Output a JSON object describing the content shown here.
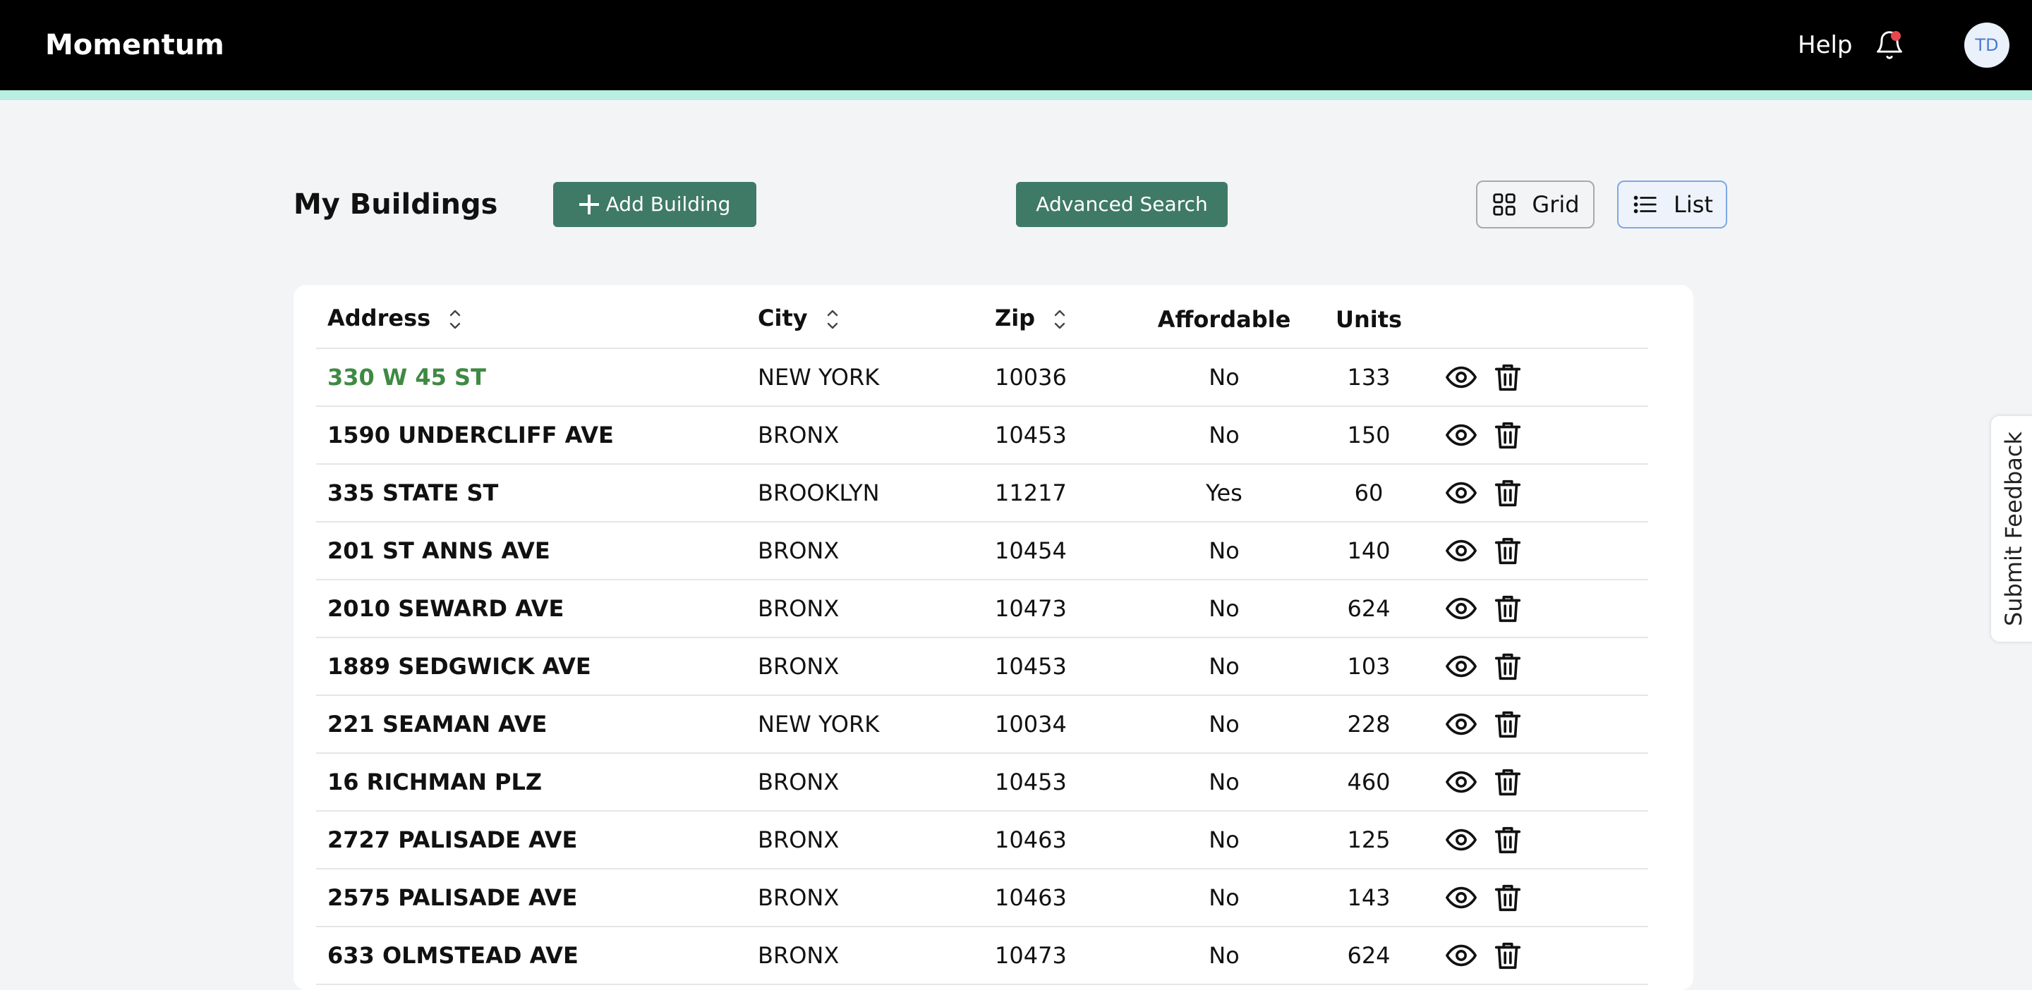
{
  "app": {
    "name": "Momentum"
  },
  "topbar": {
    "help_label": "Help",
    "avatar_initials": "TD",
    "notification_color": "#e5484d"
  },
  "header": {
    "title": "My Buildings",
    "add_button_label": "Add Building",
    "advanced_search_label": "Advanced Search",
    "view_toggle": {
      "grid_label": "Grid",
      "list_label": "List",
      "selected": "List"
    }
  },
  "table": {
    "columns": {
      "address": "Address",
      "city": "City",
      "zip": "Zip",
      "affordable": "Affordable",
      "units": "Units"
    },
    "rows": [
      {
        "address": "330 W 45 ST",
        "city": "NEW YORK",
        "zip": "10036",
        "affordable": "No",
        "units": "133"
      },
      {
        "address": "1590 UNDERCLIFF AVE",
        "city": "BRONX",
        "zip": "10453",
        "affordable": "No",
        "units": "150"
      },
      {
        "address": "335 STATE ST",
        "city": "BROOKLYN",
        "zip": "11217",
        "affordable": "Yes",
        "units": "60"
      },
      {
        "address": "201 ST ANNS AVE",
        "city": "BRONX",
        "zip": "10454",
        "affordable": "No",
        "units": "140"
      },
      {
        "address": "2010 SEWARD AVE",
        "city": "BRONX",
        "zip": "10473",
        "affordable": "No",
        "units": "624"
      },
      {
        "address": "1889 SEDGWICK AVE",
        "city": "BRONX",
        "zip": "10453",
        "affordable": "No",
        "units": "103"
      },
      {
        "address": "221 SEAMAN AVE",
        "city": "NEW YORK",
        "zip": "10034",
        "affordable": "No",
        "units": "228"
      },
      {
        "address": "16 RICHMAN PLZ",
        "city": "BRONX",
        "zip": "10453",
        "affordable": "No",
        "units": "460"
      },
      {
        "address": "2727 PALISADE AVE",
        "city": "BRONX",
        "zip": "10463",
        "affordable": "No",
        "units": "125"
      },
      {
        "address": "2575 PALISADE AVE",
        "city": "BRONX",
        "zip": "10463",
        "affordable": "No",
        "units": "143"
      },
      {
        "address": "633 OLMSTEAD AVE",
        "city": "BRONX",
        "zip": "10473",
        "affordable": "No",
        "units": "624"
      }
    ]
  },
  "feedback": {
    "label": "Submit Feedback"
  },
  "colors": {
    "brand_green": "#3f7a66",
    "link_green": "#3f8a43",
    "accent_line": "#b9eee2"
  }
}
